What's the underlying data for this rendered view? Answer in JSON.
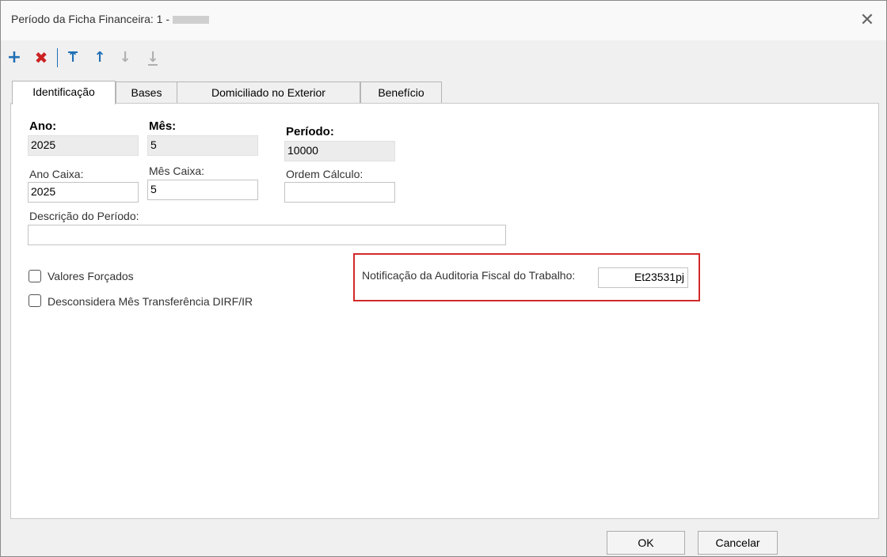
{
  "window": {
    "title": "Período da Ficha Financeira: 1 -",
    "close_glyph": "✕"
  },
  "toolbar": {
    "add_icon": "plus-icon",
    "delete_icon": "x-icon",
    "first_icon": "arrow-top-icon",
    "up_icon": "arrow-up-icon",
    "down_icon": "arrow-down-icon",
    "last_icon": "arrow-bottom-icon"
  },
  "tabs": [
    {
      "label": "Identificação"
    },
    {
      "label": "Bases"
    },
    {
      "label": "Domiciliado no Exterior"
    },
    {
      "label": "Benefício"
    }
  ],
  "form": {
    "ano_label": "Ano:",
    "ano_value": "2025",
    "mes_label": "Mês:",
    "mes_value": "5",
    "periodo_label": "Período:",
    "periodo_value": "10000",
    "ano_caixa_label": "Ano Caixa:",
    "ano_caixa_value": "2025",
    "mes_caixa_label": "Mês Caixa:",
    "mes_caixa_value": "5",
    "ordem_calculo_label": "Ordem Cálculo:",
    "ordem_calculo_value": "",
    "descricao_label": "Descrição do Período:",
    "descricao_value": "",
    "valores_forcados_label": "Valores Forçados",
    "desconsidera_label": "Desconsidera Mês Transferência DIRF/IR",
    "notificacao_label": "Notificação da Auditoria Fiscal do Trabalho:",
    "notificacao_value": "Et23531pj"
  },
  "buttons": {
    "ok": "OK",
    "cancel": "Cancelar"
  },
  "colors": {
    "accent": "#1f6fb5",
    "delete": "#cc2222",
    "highlight": "#d22a2a"
  }
}
